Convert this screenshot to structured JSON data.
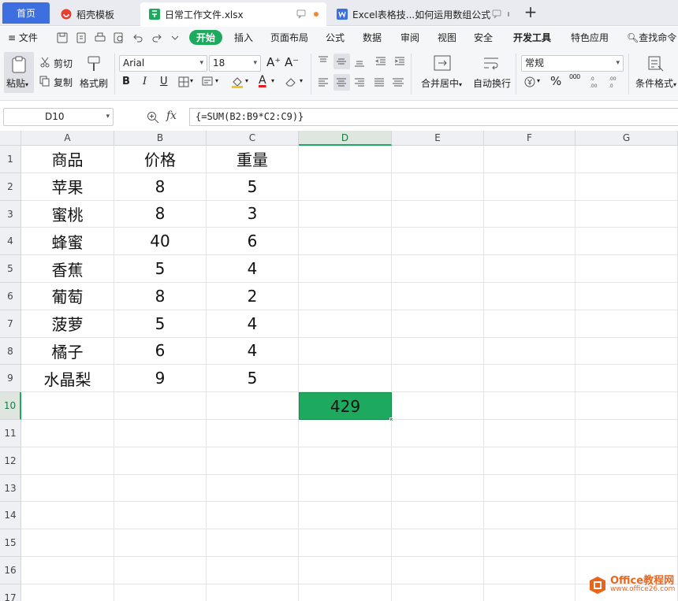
{
  "tabs": [
    {
      "label": "首页"
    },
    {
      "label": "稻壳模板"
    },
    {
      "label": "日常工作文件.xlsx"
    },
    {
      "label": "Excel表格技...如何运用数组公式"
    }
  ],
  "new_tab_symbol": "+",
  "menu": {
    "file": "文件",
    "items": [
      "开始",
      "插入",
      "页面布局",
      "公式",
      "数据",
      "审阅",
      "视图",
      "安全",
      "开发工具",
      "特色应用"
    ],
    "search": "查找命令"
  },
  "ribbon": {
    "paste": "粘贴",
    "cut": "剪切",
    "copy": "复制",
    "format_painter": "格式刷",
    "font_name": "Arial",
    "font_size": "18",
    "merge": "合并居中",
    "wrap": "自动换行",
    "number_format": "常规",
    "conditional": "条件格式",
    "bold": "B",
    "italic": "I",
    "underline": "U",
    "percent": "%",
    "thousands": "000",
    "grow_font": "A⁺",
    "shrink_font": "A⁻",
    "font_color": "A"
  },
  "formula_bar": {
    "name_box": "D10",
    "fx": "fx",
    "formula": "{=SUM(B2:B9*C2:C9)}"
  },
  "sheet": {
    "columns": [
      "A",
      "B",
      "C",
      "D",
      "E",
      "F",
      "G"
    ],
    "active_column": "D",
    "rows": [
      "1",
      "2",
      "3",
      "4",
      "5",
      "6",
      "7",
      "8",
      "9",
      "10",
      "11",
      "12",
      "13",
      "14",
      "15",
      "16",
      "17"
    ],
    "active_row": "10",
    "data": [
      [
        "商品",
        "价格",
        "重量"
      ],
      [
        "苹果",
        "8",
        "5"
      ],
      [
        "蜜桃",
        "8",
        "3"
      ],
      [
        "蜂蜜",
        "40",
        "6"
      ],
      [
        "香蕉",
        "5",
        "4"
      ],
      [
        "葡萄",
        "8",
        "2"
      ],
      [
        "菠萝",
        "5",
        "4"
      ],
      [
        "橘子",
        "6",
        "4"
      ],
      [
        "水晶梨",
        "9",
        "5"
      ]
    ],
    "result_cell": {
      "ref": "D10",
      "value": "429"
    }
  },
  "watermark": {
    "title": "Office教程网",
    "url": "www.office26.com"
  },
  "colors": {
    "accent": "#1eaa5e",
    "home_tab": "#3d6fe0",
    "watermark": "#e8651d"
  }
}
